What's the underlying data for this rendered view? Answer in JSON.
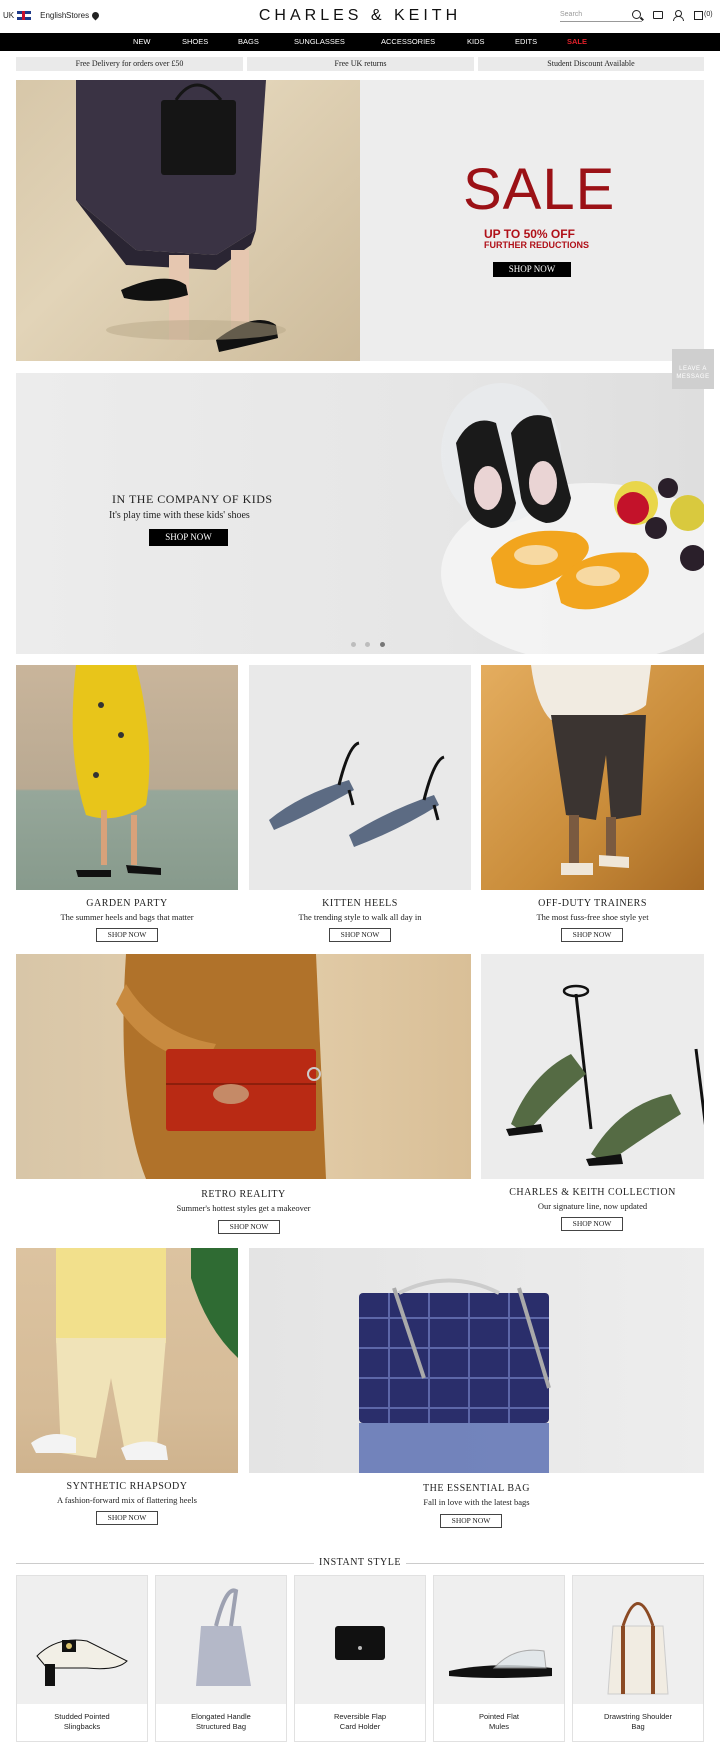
{
  "header": {
    "country": "UK",
    "language": "English",
    "stores_label": "Stores",
    "logo": "CHARLES & KEITH",
    "search_placeholder": "Search",
    "cart_count": "(0)"
  },
  "nav": {
    "items": [
      "NEW",
      "SHOES",
      "BAGS",
      "SUNGLASSES",
      "ACCESSORIES",
      "KIDS",
      "EDITS",
      "SALE"
    ]
  },
  "promos": [
    "Free Delivery for orders over £50",
    "Free UK returns",
    "Student Discount Available"
  ],
  "hero": {
    "title": "SALE",
    "subtitle1": "UP TO 50% OFF",
    "subtitle2": "FURTHER REDUCTIONS",
    "button": "SHOP NOW"
  },
  "kids_banner": {
    "title": "IN THE COMPANY OF KIDS",
    "subtitle": "It's play time with these kids' shoes",
    "button": "SHOP NOW"
  },
  "leave_message": "LEAVE A MESSAGE",
  "tiles": [
    {
      "title": "GARDEN PARTY",
      "subtitle": "The summer heels and bags that matter",
      "button": "SHOP NOW"
    },
    {
      "title": "KITTEN HEELS",
      "subtitle": "The trending style to walk all day in",
      "button": "SHOP NOW"
    },
    {
      "title": "OFF-DUTY TRAINERS",
      "subtitle": "The most fuss-free shoe style yet",
      "button": "SHOP NOW"
    },
    {
      "title": "RETRO REALITY",
      "subtitle": "Summer's hottest styles get a makeover",
      "button": "SHOP NOW"
    },
    {
      "title": "CHARLES & KEITH COLLECTION",
      "subtitle": "Our signature line, now updated",
      "button": "SHOP NOW"
    },
    {
      "title": "SYNTHETIC RHAPSODY",
      "subtitle": "A fashion-forward mix of flattering heels",
      "button": "SHOP NOW"
    },
    {
      "title": "THE ESSENTIAL BAG",
      "subtitle": "Fall in love with the latest bags",
      "button": "SHOP NOW"
    }
  ],
  "instant_style": {
    "title": "INSTANT STYLE",
    "products": [
      {
        "line1": "Studded Pointed",
        "line2": "Slingbacks"
      },
      {
        "line1": "Elongated Handle",
        "line2": "Structured Bag"
      },
      {
        "line1": "Reversible Flap",
        "line2": "Card Holder"
      },
      {
        "line1": "Pointed Flat",
        "line2": "Mules"
      },
      {
        "line1": "Drawstring Shoulder",
        "line2": "Bag"
      }
    ]
  },
  "colors": {
    "sale_red": "#9b1116",
    "nav_bg": "#000000",
    "nav_sale": "#e0202a"
  }
}
